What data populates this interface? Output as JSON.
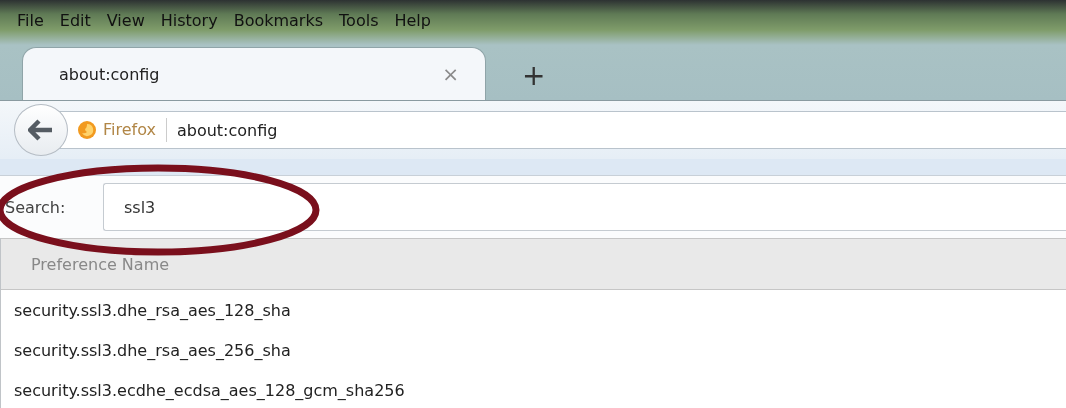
{
  "menu_bar": [
    "File",
    "Edit",
    "View",
    "History",
    "Bookmarks",
    "Tools",
    "Help"
  ],
  "tabs": [
    {
      "label": "about:config",
      "selected": true,
      "close": "×"
    }
  ],
  "new_tab": "+",
  "address_bar": {
    "identity": "Firefox",
    "url": "about:config"
  },
  "search": {
    "label": "Search:",
    "value": "ssl3"
  },
  "annotation": {
    "kind": "ellipse"
  },
  "table": {
    "columns": [
      "Preference Name"
    ],
    "rows": [
      "security.ssl3.dhe_rsa_aes_128_sha",
      "security.ssl3.dhe_rsa_aes_256_sha",
      "security.ssl3.ecdhe_ecdsa_aes_128_gcm_sha256"
    ]
  }
}
